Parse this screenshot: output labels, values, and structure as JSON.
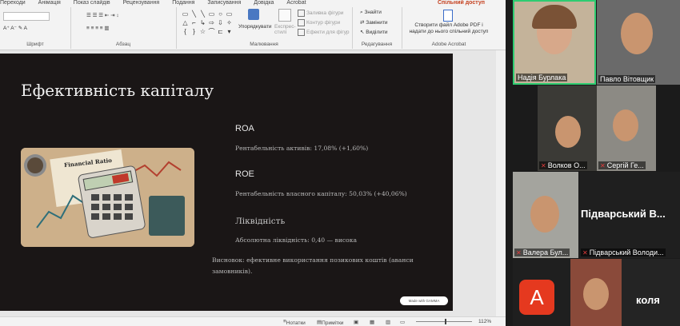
{
  "ribbon": {
    "tabs": [
      "Переходи",
      "Анімація",
      "Показ слайдів",
      "Рецензування",
      "Подання",
      "Записування",
      "Довідка",
      "Acrobat"
    ],
    "share_label": "Спільний доступ",
    "groups": {
      "font": "Шрифт",
      "paragraph": "Абзац",
      "drawing": "Малювання",
      "editing": "Редагування",
      "acrobat": "Adobe Acrobat"
    },
    "arrange_label": "Упорядкувати",
    "express_label": "Експрес-стилі",
    "fill_label": "Заливка фігури",
    "outline_label": "Контур фігури",
    "effects_label": "Ефекти для фігур",
    "find_label": "Знайти",
    "replace_label": "Замінити",
    "select_label": "Виділити",
    "acrobat_btn_line1": "Створити файл Adobe PDF і",
    "acrobat_btn_line2": "надати до нього спільний доступ"
  },
  "slide": {
    "title": "Ефективність капіталу",
    "image_caption": "Financial Ratio",
    "roa_heading": "ROA",
    "roa_text": "Рентабельність активів: 17,08% (+1,60%)",
    "roe_heading": "ROE",
    "roe_text": "Рентабельність власного капіталу: 50,03% (+40,06%)",
    "liq_heading": "Ліквідність",
    "liq_text": "Абсолютна ліквідність: 0,40 — висока",
    "conclusion_line1": "Висновок: ефективне використання позикових коштів (аванси",
    "conclusion_line2": "замовників).",
    "made_with": "Made with GAMMA"
  },
  "status": {
    "notes": "Нотатки",
    "comments": "Примітки",
    "zoom": "112%"
  },
  "participants": [
    {
      "name": "Надія Бурлака",
      "muted": false
    },
    {
      "name": "Павло Вітовщик",
      "muted": false
    },
    {
      "name": "Волков О...",
      "muted": true
    },
    {
      "name": "Сергій Ге...",
      "muted": true
    },
    {
      "name": "Валера Бул...",
      "muted": true
    },
    {
      "name": "Підварський Володи...",
      "muted": true
    },
    {
      "name": "коля",
      "muted": false
    }
  ],
  "big_labels": {
    "pidvarskyi": "Підварський В...",
    "kolia": "коля",
    "avatar_letter": "A"
  },
  "colors": {
    "slide_bg": "#1a1616",
    "active_speaker_border": "#2ecc71",
    "avatar_red": "#e5391f",
    "share_accent": "#c43e1c"
  }
}
